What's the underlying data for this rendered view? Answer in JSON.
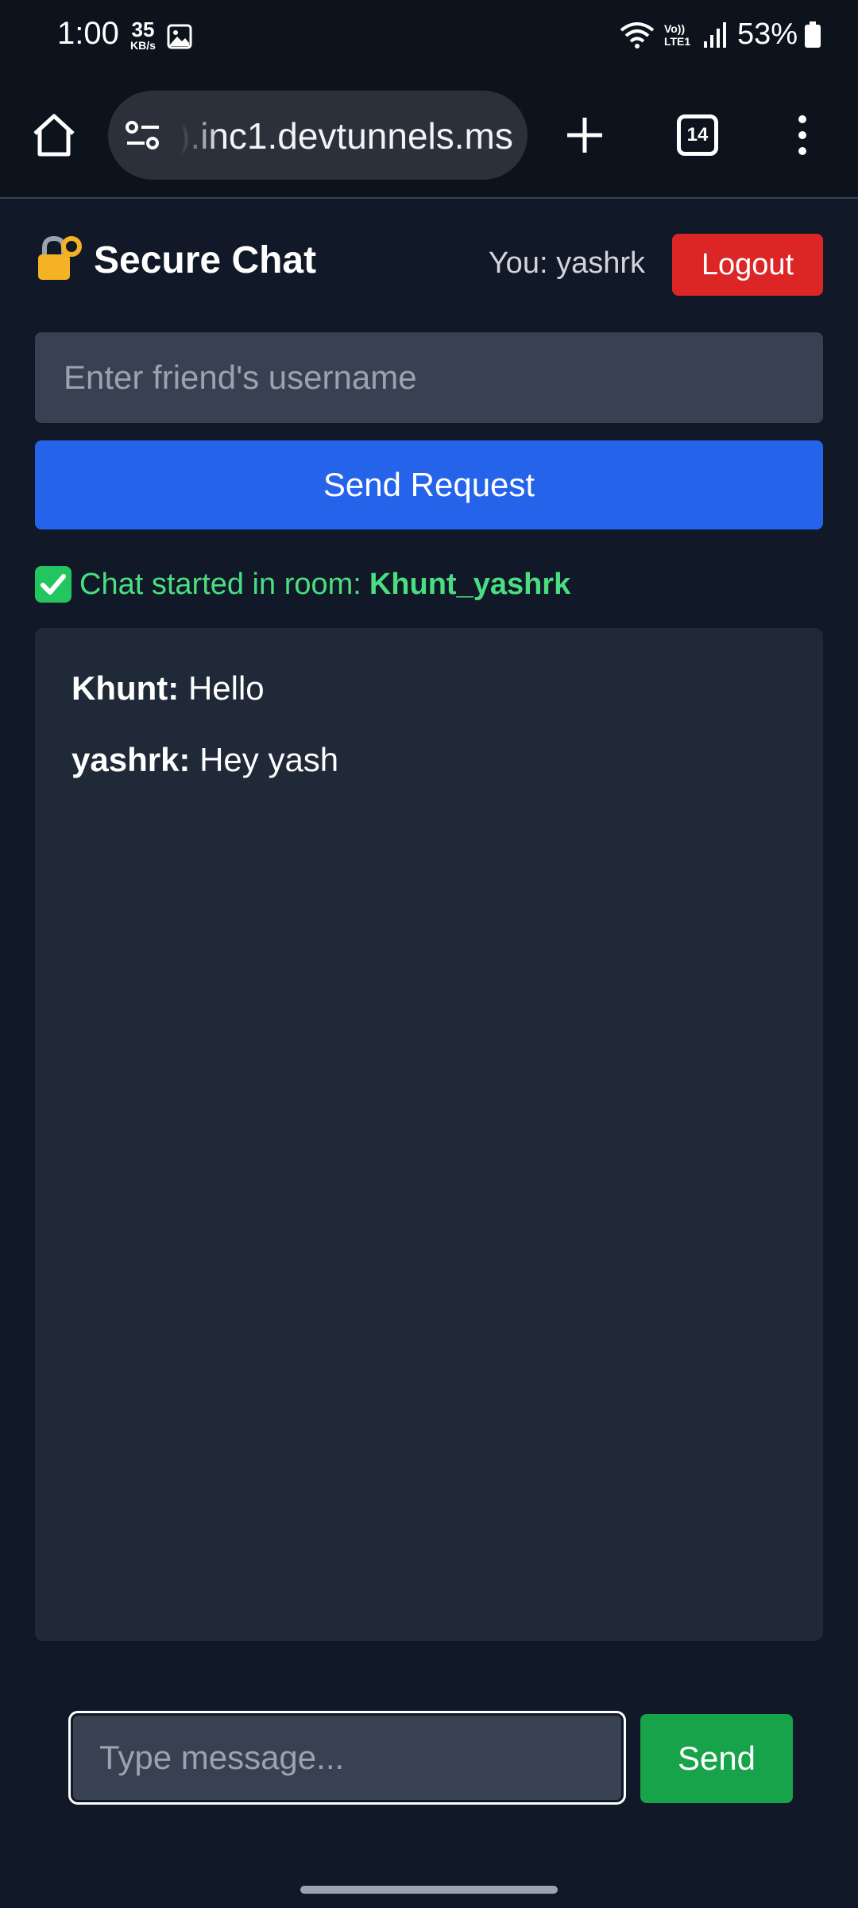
{
  "status_bar": {
    "time": "1:00",
    "speed_value": "35",
    "speed_unit": "KB/s",
    "network_label": "Vo)) LTE1",
    "battery": "53%"
  },
  "browser": {
    "url": ").inc1.devtunnels.ms",
    "tab_count": "14"
  },
  "app": {
    "title": "Secure Chat",
    "user_label": "You: yashrk",
    "logout_label": "Logout",
    "friend_input_placeholder": "Enter friend's username",
    "friend_input_value": "",
    "send_request_label": "Send Request",
    "room_status_prefix": "Chat started in room:",
    "room_name": "Khunt_yashrk"
  },
  "messages": [
    {
      "author": "Khunt:",
      "text": "Hello"
    },
    {
      "author": "yashrk:",
      "text": "Hey yash"
    }
  ],
  "composer": {
    "placeholder": "Type message...",
    "value": "",
    "send_label": "Send"
  },
  "colors": {
    "background": "#111827",
    "panel": "#1f2937",
    "input": "#374151",
    "primary": "#2563eb",
    "danger": "#dc2626",
    "success": "#16a34a",
    "status_text": "#4ade80"
  }
}
